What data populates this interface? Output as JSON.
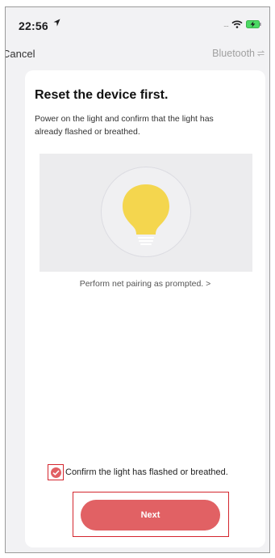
{
  "status_bar": {
    "time": "22:56",
    "signal": "....",
    "icons": [
      "location-arrow-icon",
      "wifi-icon",
      "battery-charging-icon"
    ]
  },
  "nav": {
    "cancel_label": "Cancel",
    "mode_label": "Bluetooth",
    "mode_icon": "switch-arrows-icon"
  },
  "card": {
    "title": "Reset the device first.",
    "description": "Power on the light and confirm that the light has already flashed or breathed.",
    "illustration_icon": "light-bulb-icon",
    "pairing_link": "Perform net pairing as prompted. >",
    "confirm_label": "Confirm the light has flashed or breathed.",
    "confirm_checked": true,
    "next_label": "Next"
  },
  "colors": {
    "accent": "#e16164",
    "highlight_frame": "#d4262e",
    "bulb": "#f4d64e",
    "background": "#f2f2f4"
  }
}
